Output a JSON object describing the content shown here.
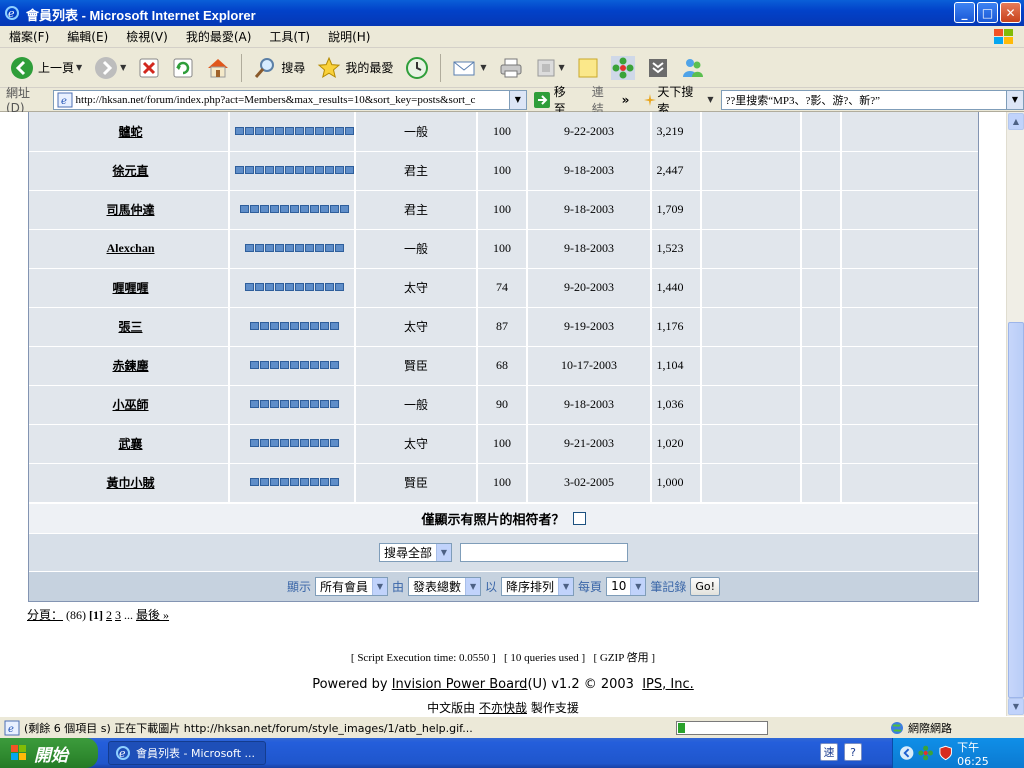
{
  "window": {
    "title": "會員列表 - Microsoft Internet Explorer",
    "min": "_",
    "max": "□",
    "close": "✕"
  },
  "menu": [
    "檔案(F)",
    "編輯(E)",
    "檢視(V)",
    "我的最愛(A)",
    "工具(T)",
    "說明(H)"
  ],
  "toolbar": {
    "back": "上一頁",
    "search": "搜尋",
    "favorites": "我的最愛"
  },
  "address": {
    "label": "網址(D)",
    "url": "http://hksan.net/forum/index.php?act=Members&max_results=10&sort_key=posts&sort_c",
    "go": "移至",
    "links": "連結",
    "search_brand": "天下搜索",
    "search_text": "??里搜索“MP3、?影、游?、新?”"
  },
  "members": [
    {
      "name": "髗蛇",
      "rank_pips": 12,
      "group": "一般",
      "rating": "100",
      "joined": "9-22-2003",
      "posts": "3,219"
    },
    {
      "name": "徐元直",
      "rank_pips": 12,
      "group": "君主",
      "rating": "100",
      "joined": "9-18-2003",
      "posts": "2,447"
    },
    {
      "name": "司馬仲達",
      "rank_pips": 11,
      "group": "君主",
      "rating": "100",
      "joined": "9-18-2003",
      "posts": "1,709"
    },
    {
      "name": "Alexchan",
      "rank_pips": 10,
      "group": "一般",
      "rating": "100",
      "joined": "9-18-2003",
      "posts": "1,523"
    },
    {
      "name": "喱喱喱",
      "rank_pips": 10,
      "group": "太守",
      "rating": "74",
      "joined": "9-20-2003",
      "posts": "1,440"
    },
    {
      "name": "張三",
      "rank_pips": 9,
      "group": "太守",
      "rating": "87",
      "joined": "9-19-2003",
      "posts": "1,176"
    },
    {
      "name": "赤鍊塵",
      "rank_pips": 9,
      "group": "賢臣",
      "rating": "68",
      "joined": "10-17-2003",
      "posts": "1,104"
    },
    {
      "name": "小巫師",
      "rank_pips": 9,
      "group": "一般",
      "rating": "90",
      "joined": "9-18-2003",
      "posts": "1,036"
    },
    {
      "name": "武襄",
      "rank_pips": 9,
      "group": "太守",
      "rating": "100",
      "joined": "9-21-2003",
      "posts": "1,020"
    },
    {
      "name": "黃巾小賊",
      "rank_pips": 9,
      "group": "賢臣",
      "rating": "100",
      "joined": "3-02-2005",
      "posts": "1,000"
    }
  ],
  "photo_only": {
    "label": "僅顯示有照片的相符者？",
    "checked": false
  },
  "search": {
    "select": "搜尋全部",
    "value": ""
  },
  "filter": {
    "show": "顯示",
    "group_select": "所有會員",
    "by": "由",
    "sort_select": "發表總數",
    "with": "以",
    "order_select": "降序排列",
    "per_page": "每頁",
    "count_select": "10",
    "records": "筆記錄",
    "go": "Go!"
  },
  "pager": {
    "label": "分頁：",
    "total": "(86)",
    "current": "[1]",
    "p2": "2",
    "p3": "3",
    "ellipsis": "...",
    "last": "最後 »"
  },
  "footer": {
    "stats": "[ Script Execution time: 0.0550 ]   [ 10 queries used ]   [ GZIP 啓用 ]",
    "powered_prefix": "Powered by ",
    "powered_link": "Invision Power Board",
    "powered_suffix": "(U) v1.2 © 2003  ",
    "ips": "IPS, Inc.",
    "support_prefix": "中文版由 ",
    "support_link": "不亦快哉",
    "support_suffix": " 製作支援"
  },
  "status": {
    "text": "(剩餘 6 個項目 s) 正在下載圖片 http://hksan.net/forum/style_images/1/atb_help.gif...",
    "progress": 0.08,
    "zone": "網際網路"
  },
  "taskbar": {
    "start": "開始",
    "task": "會員列表 - Microsoft ...",
    "clock": "下午 06:25"
  },
  "colors": {
    "row_bg": "#e1e6ec",
    "pip": "#5f8ec9",
    "titlebar": "#0a5fd8"
  }
}
